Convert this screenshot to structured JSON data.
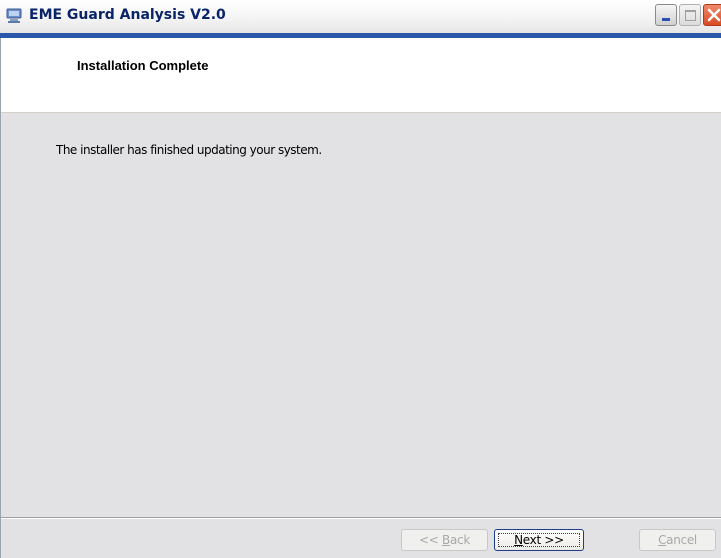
{
  "window": {
    "title": "EME Guard Analysis V2.0",
    "app_icon": "installer-icon"
  },
  "header": {
    "title": "Installation Complete"
  },
  "content": {
    "message": "The installer has finished updating your system."
  },
  "buttons": {
    "back": {
      "prefix": "<< ",
      "mnemonic": "B",
      "rest": "ack",
      "enabled": false
    },
    "next": {
      "mnemonic": "N",
      "rest": "ext >>",
      "enabled": true,
      "focused": true
    },
    "cancel": {
      "mnemonic": "C",
      "rest": "ancel",
      "enabled": false
    }
  },
  "colors": {
    "title_text": "#0a246a",
    "title_underline": "#2a58a8",
    "close_button": "#d84a23",
    "content_background": "#e2e2e4"
  }
}
